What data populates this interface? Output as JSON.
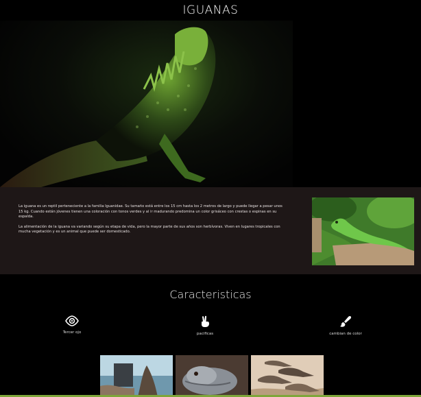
{
  "header": {
    "title": "IGUANAS"
  },
  "hero": {
    "image": "iguana-dark-photo"
  },
  "info": {
    "paragraph1": "La iguana es un reptil perteneciente a la familia Iguanidae. Su tamaño está entre los 15 cm hasta los 2 metros de largo y puede llegar a pesar unos 15 kg. Cuando están jóvenes tienen una coloración con tonos verdes y al ir madurando predomina un color grisáceo con crestas o espinas en su espalda.",
    "paragraph2": "La alimentación de la iguana va variando según su etapa de vida, pero la mayor parte de sus años son herbívoras. Viven en lugares tropicales con mucha vegetación y es un animal que puede ser domesticado.",
    "thumb_image": "green-iguana-photo"
  },
  "caracteristicas": {
    "title": "Caracteristicas",
    "items": [
      {
        "icon": "eye-icon",
        "label": "Tercer ojo"
      },
      {
        "icon": "peace-hand-icon",
        "label": "pacificas"
      },
      {
        "icon": "paintbrush-icon",
        "label": "cambian de color"
      }
    ]
  },
  "gallery": [
    "iguana-beach-photo",
    "iguana-closeup-photo",
    "iguanas-group-photo"
  ],
  "colors": {
    "accent": "#7ea63a",
    "info_bg": "#1e1717"
  }
}
